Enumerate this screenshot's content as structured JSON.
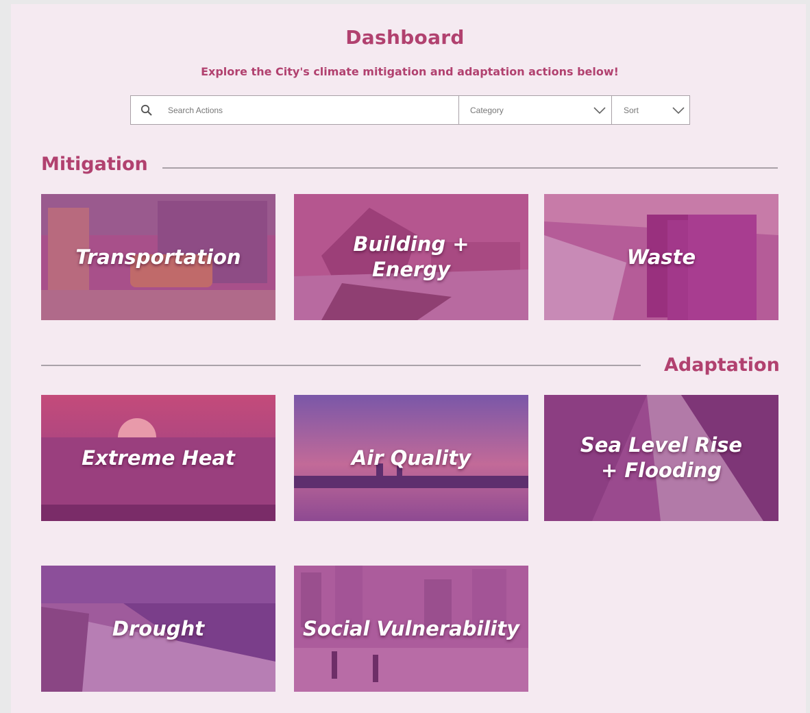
{
  "header": {
    "title": "Dashboard",
    "subtitle": "Explore the City's climate mitigation and adaptation actions below!"
  },
  "search": {
    "icon": "search-icon",
    "placeholder": "Search Actions",
    "category_label": "Category",
    "sort_label": "Sort"
  },
  "sections": {
    "mitigation": {
      "title": "Mitigation",
      "tiles": [
        "Transportation",
        "Building +\nEnergy",
        "Waste"
      ]
    },
    "adaptation": {
      "title": "Adaptation",
      "tiles": [
        "Extreme Heat",
        "Air Quality",
        "Sea Level Rise\n+ Flooding",
        "Drought",
        "Social Vulnerability"
      ]
    }
  },
  "colors": {
    "accent": "#b1416f",
    "page_background": "#f5eaf1",
    "tile_overlay": "#a8438c"
  }
}
